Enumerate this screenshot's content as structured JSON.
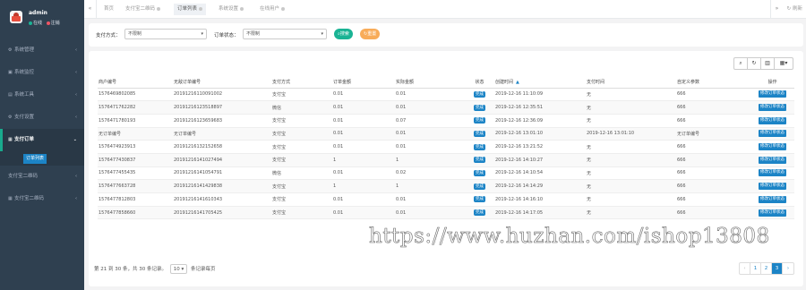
{
  "sidebar": {
    "user": {
      "name": "admin",
      "status_online": "在线",
      "status_logout": "注销"
    },
    "items": [
      {
        "label": "系统管理",
        "icon": "gear-icon",
        "active": false
      },
      {
        "label": "系统监控",
        "icon": "monitor-icon",
        "active": false
      },
      {
        "label": "系统工具",
        "icon": "tool-icon",
        "active": false
      },
      {
        "label": "支付设置",
        "icon": "gear-icon",
        "active": false
      },
      {
        "label": "支付订单",
        "icon": "list-icon",
        "active": true
      },
      {
        "label": "支付宝二维码",
        "icon": "qrcode-icon",
        "active": false
      },
      {
        "label": "支付宝二维码",
        "icon": "qrcode-icon",
        "active": false
      }
    ],
    "submenu_active": "订单列表"
  },
  "tabs": {
    "items": [
      "首页",
      "支付宝二维码",
      "订单列表",
      "系统设置",
      "在线用户"
    ],
    "active_index": 2,
    "refresh_label": "刷新"
  },
  "search": {
    "pay_method_label": "支付方式：",
    "pay_method_value": "不限制",
    "order_status_label": "订单状态：",
    "order_status_value": "不限制",
    "search_button": "搜索",
    "reset_button": "重置"
  },
  "table": {
    "columns": [
      "商户编号",
      "无敌订单编号",
      "支付方式",
      "订单金额",
      "实际金额",
      "状态",
      "创建时间",
      "支付时间",
      "自定义参数",
      "操作"
    ],
    "op_label": "修改订单状态",
    "rows": [
      {
        "merchant": "1576469802085",
        "order_no": "20191216110091002",
        "method": "支付宝",
        "amount": "0.01",
        "actual": "0.01",
        "status": "完成",
        "created": "2019-12-16 11:10:09",
        "paid": "无",
        "param": "666"
      },
      {
        "merchant": "1576471762282",
        "order_no": "20191216123518897",
        "method": "微信",
        "amount": "0.01",
        "actual": "0.01",
        "status": "完成",
        "created": "2019-12-16 12:35:51",
        "paid": "无",
        "param": "666"
      },
      {
        "merchant": "1576471780193",
        "order_no": "20191216123659683",
        "method": "支付宝",
        "amount": "0.01",
        "actual": "0.07",
        "status": "完成",
        "created": "2019-12-16 12:36:09",
        "paid": "无",
        "param": "666"
      },
      {
        "merchant": "无订单编号",
        "order_no": "无订单编号",
        "method": "支付宝",
        "amount": "0.01",
        "actual": "0.01",
        "status": "完成",
        "created": "2019-12-16 13:01:10",
        "paid": "2019-12-16 13:01:10",
        "param": "无订单编号"
      },
      {
        "merchant": "1576474923913",
        "order_no": "20191216132152658",
        "method": "支付宝",
        "amount": "0.01",
        "actual": "0.01",
        "status": "完成",
        "created": "2019-12-16 13:21:52",
        "paid": "无",
        "param": "666"
      },
      {
        "merchant": "1576477430837",
        "order_no": "20191216141027494",
        "method": "支付宝",
        "amount": "1",
        "actual": "1",
        "status": "完成",
        "created": "2019-12-16 14:10:27",
        "paid": "无",
        "param": "666"
      },
      {
        "merchant": "1576477455435",
        "order_no": "20191216141054791",
        "method": "微信",
        "amount": "0.01",
        "actual": "0.02",
        "status": "完成",
        "created": "2019-12-16 14:10:54",
        "paid": "无",
        "param": "666"
      },
      {
        "merchant": "1576477663728",
        "order_no": "20191216141429838",
        "method": "支付宝",
        "amount": "1",
        "actual": "1",
        "status": "完成",
        "created": "2019-12-16 14:14:29",
        "paid": "无",
        "param": "666"
      },
      {
        "merchant": "1576477812803",
        "order_no": "20191216141610343",
        "method": "支付宝",
        "amount": "0.01",
        "actual": "0.01",
        "status": "完成",
        "created": "2019-12-16 14:16:10",
        "paid": "无",
        "param": "666"
      },
      {
        "merchant": "1576477858660",
        "order_no": "20191216141705425",
        "method": "支付宝",
        "amount": "0.01",
        "actual": "0.01",
        "status": "完成",
        "created": "2019-12-16 14:17:05",
        "paid": "无",
        "param": "666"
      }
    ]
  },
  "pagination": {
    "info": "第 21 到 30 条，共 30 条记录。",
    "page_size": "10",
    "page_size_suffix": "条记录每页",
    "pages": [
      "‹",
      "1",
      "2",
      "3",
      "›"
    ],
    "active_page": "3"
  },
  "watermark": "https://www.huzhan.com/ishop13808",
  "colors": {
    "sidebar_bg": "#2f4050",
    "accent_blue": "#1c84c6",
    "green": "#1ab394",
    "orange": "#f8ac59"
  }
}
